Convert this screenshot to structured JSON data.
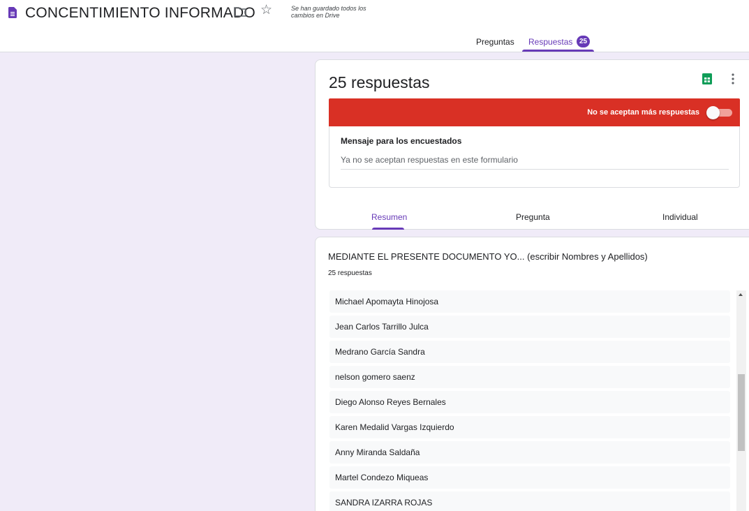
{
  "header": {
    "app_title": "CONCENTIMIENTO INFORMADO",
    "saved_status_line1": "Se han guardado todos los",
    "saved_status_line2": "cambios en Drive",
    "tabs": [
      {
        "label": "Preguntas"
      },
      {
        "label": "Respuestas",
        "badge": "25",
        "active": true
      }
    ],
    "icons": {
      "doc": "forms-doc-icon",
      "folder": "folder-icon",
      "star": "star-outline-icon"
    }
  },
  "summary_card": {
    "count_title": "25 respuestas",
    "banner_label": "No se aceptan más respuestas",
    "accepting_responses": false,
    "message_label": "Mensaje para los encuestados",
    "message_value": "Ya no se aceptan respuestas en este formulario",
    "subtabs": [
      {
        "label": "Resumen",
        "active": true
      },
      {
        "label": "Pregunta"
      },
      {
        "label": "Individual"
      }
    ]
  },
  "question_card": {
    "title": "MEDIANTE EL PRESENTE DOCUMENTO YO... (escribir Nombres y Apellidos)",
    "count": "25 respuestas",
    "answers": [
      "Michael Apomayta Hinojosa",
      "Jean Carlos Tarrillo Julca",
      "Medrano García Sandra",
      "nelson gomero saenz",
      "Diego Alonso Reyes Bernales",
      "Karen Medalid Vargas Izquierdo",
      "Anny Miranda Saldaña",
      "Martel Condezo Miqueas",
      "SANDRA IZARRA ROJAS"
    ]
  },
  "colors": {
    "accent": "#673ab7",
    "banner_red": "#d93025",
    "page_bg": "#f0ebf8",
    "sheets_green": "#0f9d58"
  }
}
